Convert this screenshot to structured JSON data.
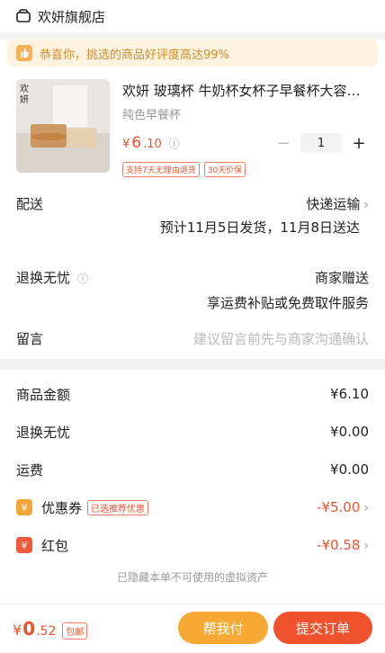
{
  "header": {
    "shop_name": "欢妍旗舰店"
  },
  "banner": {
    "text": "恭喜你，挑选的商品好评度高达99%"
  },
  "product": {
    "title": "欢妍 玻璃杯 牛奶杯女杯子早餐杯大容…",
    "spec": "纯色早餐杯",
    "price_symbol": "¥",
    "price_int": "6",
    "price_dec": ".10",
    "qty": "1",
    "minus": "−",
    "plus": "+",
    "tags": [
      "支持7天无理由退货",
      "30天价保"
    ]
  },
  "delivery": {
    "label": "配送",
    "method": "快递运输",
    "eta": "预计11月5日发货，11月8日送达"
  },
  "returns": {
    "label": "退换无忧",
    "value": "商家赠送",
    "detail": "享运费补贴或免费取件服务"
  },
  "message": {
    "label": "留言",
    "placeholder": "建议留言前先与商家沟通确认"
  },
  "summary": {
    "goods_label": "商品金额",
    "goods_value": "¥6.10",
    "returns_label": "退换无忧",
    "returns_value": "¥0.00",
    "freight_label": "运费",
    "freight_value": "¥0.00",
    "coupon_label": "优惠券",
    "coupon_badge": "已选推荐优惠",
    "coupon_value": "-¥5.00",
    "redpacket_label": "红包",
    "redpacket_value": "-¥0.58"
  },
  "footer_note": "已隐藏本单不可使用的虚拟资产",
  "bottom": {
    "total_symbol": "¥",
    "total_int": "0",
    "total_dec": ".52",
    "shipping_badge": "包邮",
    "help_pay": "帮我付",
    "pay": "提交订单"
  },
  "colors": {
    "accent": "#e8542d",
    "help": "#f7a935",
    "pay": "#f0522d"
  }
}
